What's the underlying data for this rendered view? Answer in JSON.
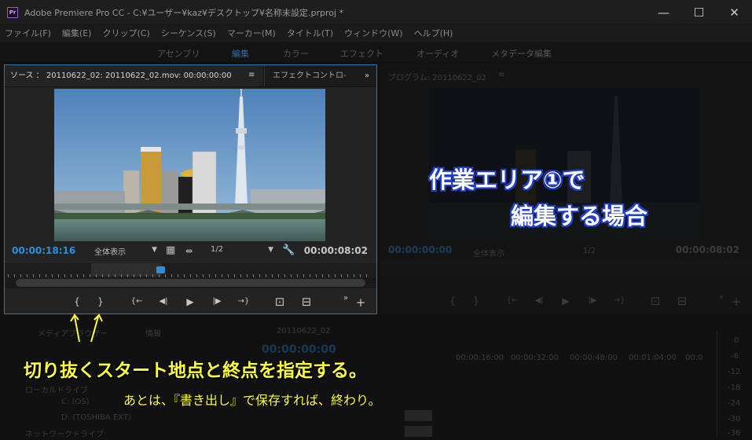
{
  "window": {
    "title": "Adobe Premiere Pro CC - C:¥ユーザー¥kaz¥デスクトップ¥名称未設定.prproj *",
    "minimize": "—",
    "maximize": "☐",
    "close": "✕",
    "app_icon_text": "Pr"
  },
  "menu": [
    "ファイル(F)",
    "編集(E)",
    "クリップ(C)",
    "シーケンス(S)",
    "マーカー(M)",
    "タイトル(T)",
    "ウィンドウ(W)",
    "ヘルプ(H)"
  ],
  "workspaces": [
    "アセンブリ",
    "編集",
    "カラー",
    "エフェクト",
    "オーディオ",
    "メタデータ編集"
  ],
  "source_panel": {
    "tab_label": "ソース ： 20110622_02:  20110622_02.mov: 00:00:00:00",
    "tab_menu": "≡",
    "effects_tab": "エフェクトコントロ-",
    "overflow": "»",
    "playhead_timecode": "00:00:18:16",
    "zoom_level": "全体表示",
    "resolution": "1/2",
    "duration_timecode": "00:00:08:02"
  },
  "transport": {
    "mark_in": "{",
    "mark_out": "}",
    "go_to_in": "{←",
    "step_back": "◀|",
    "play": "▶",
    "step_forward": "|▶",
    "go_to_out": "→}",
    "insert": "⊡",
    "overwrite": "⊟",
    "more": "»",
    "add": "+"
  },
  "program_panel": {
    "tab_label": "プログラム: 20110622_02",
    "tab_menu": "≡",
    "playhead_timecode": "00:00:00:00",
    "zoom_level": "全体表示",
    "resolution": "1/2",
    "duration_timecode": "00:00:08:02"
  },
  "bottom": {
    "project_tab": "メディアブラウザー",
    "info_tab": "情報",
    "local_drives": "ローカルドライブ",
    "drive_c": "C: (OS)",
    "drive_d": "D: (TOSHIBA EXT)",
    "network_drives": "ネットワークドライブ",
    "sequence_tab": "20110622_02",
    "sequence_timecode": "00:00:00:00",
    "ruler_labels": [
      "00:00:16:00",
      "00:00:32:00",
      "00:00:48:00",
      "00:01:04:00",
      "00:0"
    ],
    "meter_labels": [
      "0",
      "-6",
      "-12",
      "-18",
      "-24",
      "-30",
      "-36"
    ]
  },
  "annotations": {
    "callout_line1": "作業エリア①で",
    "callout_line2": "編集する場合",
    "caption_main": "切り抜くスタート地点と終点を指定する。",
    "caption_sub": "あとは、『書き出し』で保存すれば、終わり。"
  },
  "colors": {
    "accent_blue": "#2e8fd9",
    "caption_yellow": "#ffff3c",
    "callout_outline": "#2c4bd9"
  }
}
